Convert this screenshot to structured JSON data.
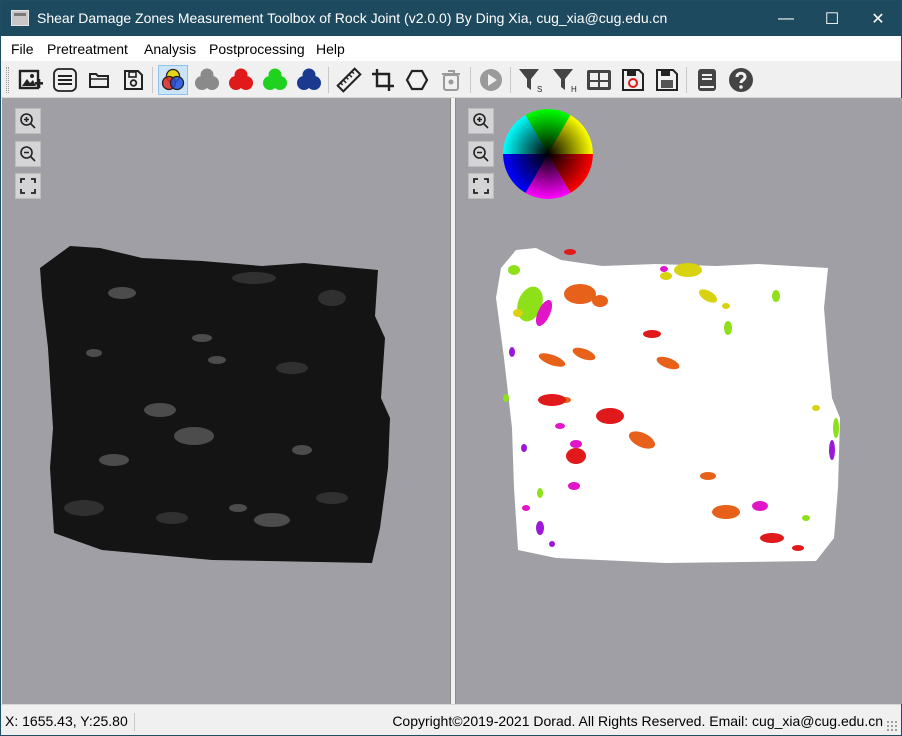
{
  "window": {
    "title": "Shear Damage Zones Measurement Toolbox of Rock Joint (v2.0.0) By Ding Xia, cug_xia@cug.edu.cn",
    "minimize_glyph": "—",
    "maximize_glyph": "☐",
    "close_glyph": "✕"
  },
  "menu": {
    "file": "File",
    "pretreatment": "Pretreatment",
    "analysis": "Analysis",
    "postprocessing": "Postprocessing",
    "help": "Help"
  },
  "toolbar": {
    "buttons": [
      {
        "icon": "import-image-icon"
      },
      {
        "icon": "text-list-icon"
      },
      {
        "icon": "open-folder-icon"
      },
      {
        "icon": "save-icon"
      },
      {
        "icon": "rgb-channels-icon",
        "active": true
      },
      {
        "icon": "gray-channel-icon",
        "color": "#8a8a8a"
      },
      {
        "icon": "red-channel-icon",
        "color": "#e0191b"
      },
      {
        "icon": "green-channel-icon",
        "color": "#1fd21f"
      },
      {
        "icon": "blue-channel-icon",
        "color": "#1b3a8f"
      },
      {
        "icon": "ruler-icon"
      },
      {
        "icon": "crop-icon"
      },
      {
        "icon": "polygon-icon"
      },
      {
        "icon": "delete-icon"
      },
      {
        "icon": "run-icon"
      },
      {
        "icon": "filter-s-icon",
        "subscript": "S"
      },
      {
        "icon": "filter-h-icon",
        "subscript": "H"
      },
      {
        "icon": "table-icon"
      },
      {
        "icon": "save-result-icon"
      },
      {
        "icon": "save-data-icon"
      },
      {
        "icon": "manual-icon"
      },
      {
        "icon": "help-icon"
      }
    ]
  },
  "colors": {
    "titlebar": "#1e4a5f",
    "canvas": "#a09fa5",
    "rock": "#141414",
    "damage_red": "#e0191b",
    "damage_orange": "#e8611a",
    "damage_yellow": "#d8d20f",
    "damage_green": "#8ee019",
    "damage_magenta": "#e016c8",
    "damage_purple": "#9a1ad8"
  },
  "status": {
    "coords": "X: 1655.43, Y:25.80",
    "copyright": "Copyright©2019-2021 Dorad. All Rights Reserved. Email: cug_xia@cug.edu.cn"
  }
}
